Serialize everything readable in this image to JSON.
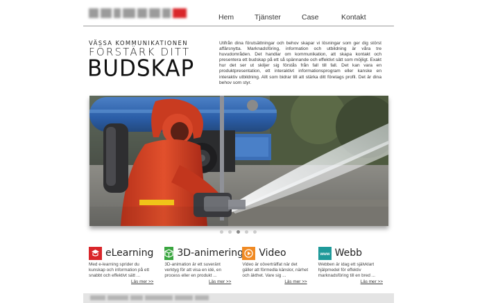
{
  "nav": {
    "items": [
      {
        "label": "Hem"
      },
      {
        "label": "Tjänster"
      },
      {
        "label": "Case"
      },
      {
        "label": "Kontakt"
      }
    ]
  },
  "hero": {
    "tagline": "VÄSSA KOMMUNIKATIONEN",
    "headline_line1": "FÖRSTÄRK DITT",
    "headline_line2": "BUDSKAP",
    "intro": "Utifrån dina förutsättningar och behov skapar vi lösningar som ger dig störst affärsnytta. Marknadsföring, information och utbildning är våra tre huvudområden. Det handlar om kommunikation, att skapa kontakt och presentera ett budskap på ett så spännande och effektivt sätt som möjligt. Exakt hur det ser ut skiljer sig förstås från fall till fall. Det kan vara en produktpresentation, ett interaktivt informationsprogram eller kanske en interaktiv utbildning. Allt som bidrar till att stärka ditt företags profil. Det är dina behov som styr."
  },
  "slider": {
    "dots": 5,
    "active_index": 2
  },
  "features": [
    {
      "title": "eLearning",
      "icon": "elearning-icon",
      "color": "#d9262a",
      "text": "Med e-learning sprider du kunskap och information på ett snabbt och effektivt sätt ...",
      "more": "Läs mer >>"
    },
    {
      "title": "3D-animering",
      "icon": "cube-icon",
      "color": "#3aa640",
      "text": "3D-animation är ett suveränt verktyg för att visa en idé, en process eller en produkt ...",
      "more": "Läs mer >>"
    },
    {
      "title": "Video",
      "icon": "play-icon",
      "color": "#f08a24",
      "text": "Video är oöverträffat när det gäller att förmedla känslor, närhet och äkthet. Vare sig ...",
      "more": "Läs mer >>"
    },
    {
      "title": "Webb",
      "icon": "www-icon",
      "color": "#1f9a9a",
      "text": "Webben är idag ett självklart hjälpmedel för effektiv marknadsföring till en bred ...",
      "more": "Läs mer >>"
    }
  ]
}
